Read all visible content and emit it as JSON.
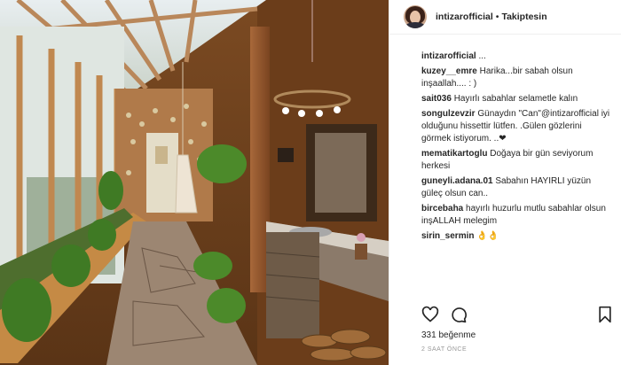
{
  "post": {
    "image_name": "greenhouse-corridor-photo",
    "username": "intizarofficial",
    "separator": "•",
    "follow_status": "Takiptesin",
    "caption_user": "intizarofficial",
    "caption_text": "...",
    "likes": "331 beğenme",
    "timestamp": "2 SAAT ÖNCE"
  },
  "comments": [
    {
      "user": "kuzey__emre",
      "text": "Harika...bir sabah olsun inşaallah.... : )"
    },
    {
      "user": "sait036",
      "text": "Hayırlı sabahlar selametle kalın"
    },
    {
      "user": "songulzevzir",
      "text": "Günaydın \"Can\"@intizarofficial iyi olduğunu hissettir lütfen. .Gülen gözlerini görmek istiyorum. ..❤"
    },
    {
      "user": "mematikartoglu",
      "text": "Doğaya bir gün seviyorum herkesi"
    },
    {
      "user": "guneyli.adana.01",
      "text": "Sabahın HAYIRLI yüzün güleç olsun can.."
    },
    {
      "user": "bircebaha",
      "text": "hayırlı huzurlu mutlu sabahlar olsun inşALLAH melegim"
    },
    {
      "user": "sirin_sermin",
      "text": "👌👌"
    }
  ],
  "icons": [
    "heart-icon",
    "comment-icon",
    "bookmark-icon"
  ],
  "colors": {
    "text": "#262626",
    "muted": "#999999",
    "border": "#efefef"
  }
}
